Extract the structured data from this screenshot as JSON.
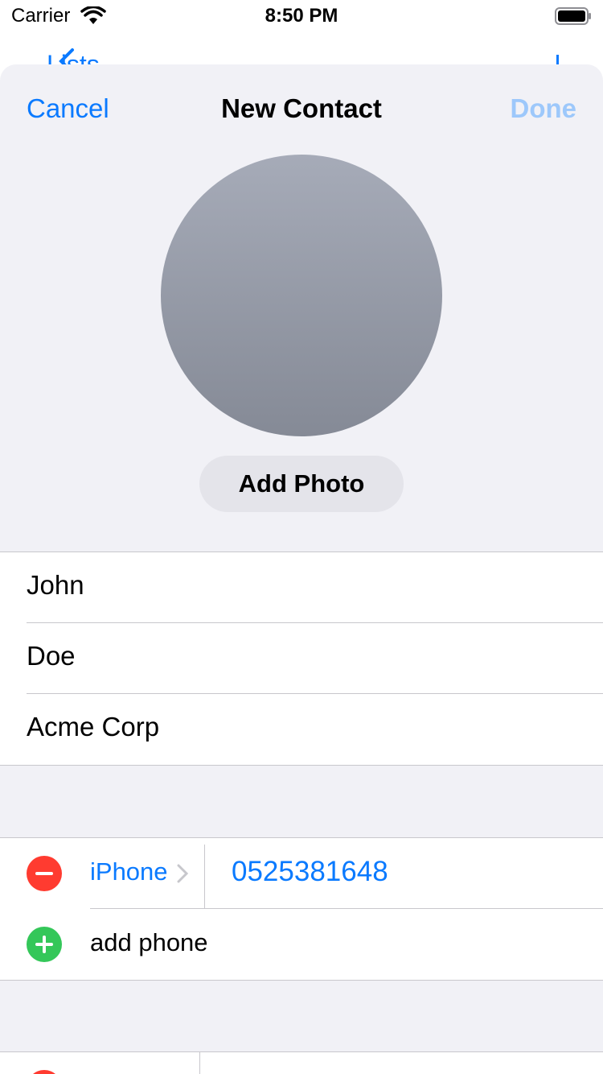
{
  "status_bar": {
    "carrier": "Carrier",
    "time": "8:50 PM",
    "wifi_icon": "wifi-icon",
    "battery_icon": "battery-icon"
  },
  "background_nav": {
    "back_label": "Lists"
  },
  "sheet": {
    "cancel_label": "Cancel",
    "title": "New Contact",
    "done_label": "Done",
    "add_photo_label": "Add Photo"
  },
  "name_fields": {
    "first_name": "John",
    "last_name": "Doe",
    "company": "Acme Corp"
  },
  "phone_section": {
    "phones": [
      {
        "label": "iPhone",
        "value": "0525381648"
      }
    ],
    "add_phone_label": "add phone"
  },
  "colors": {
    "accent": "#0a7aff",
    "accent_disabled": "#9dc8fb",
    "delete": "#ff3b30",
    "add": "#34c759",
    "sheet_background": "#f1f1f6"
  }
}
